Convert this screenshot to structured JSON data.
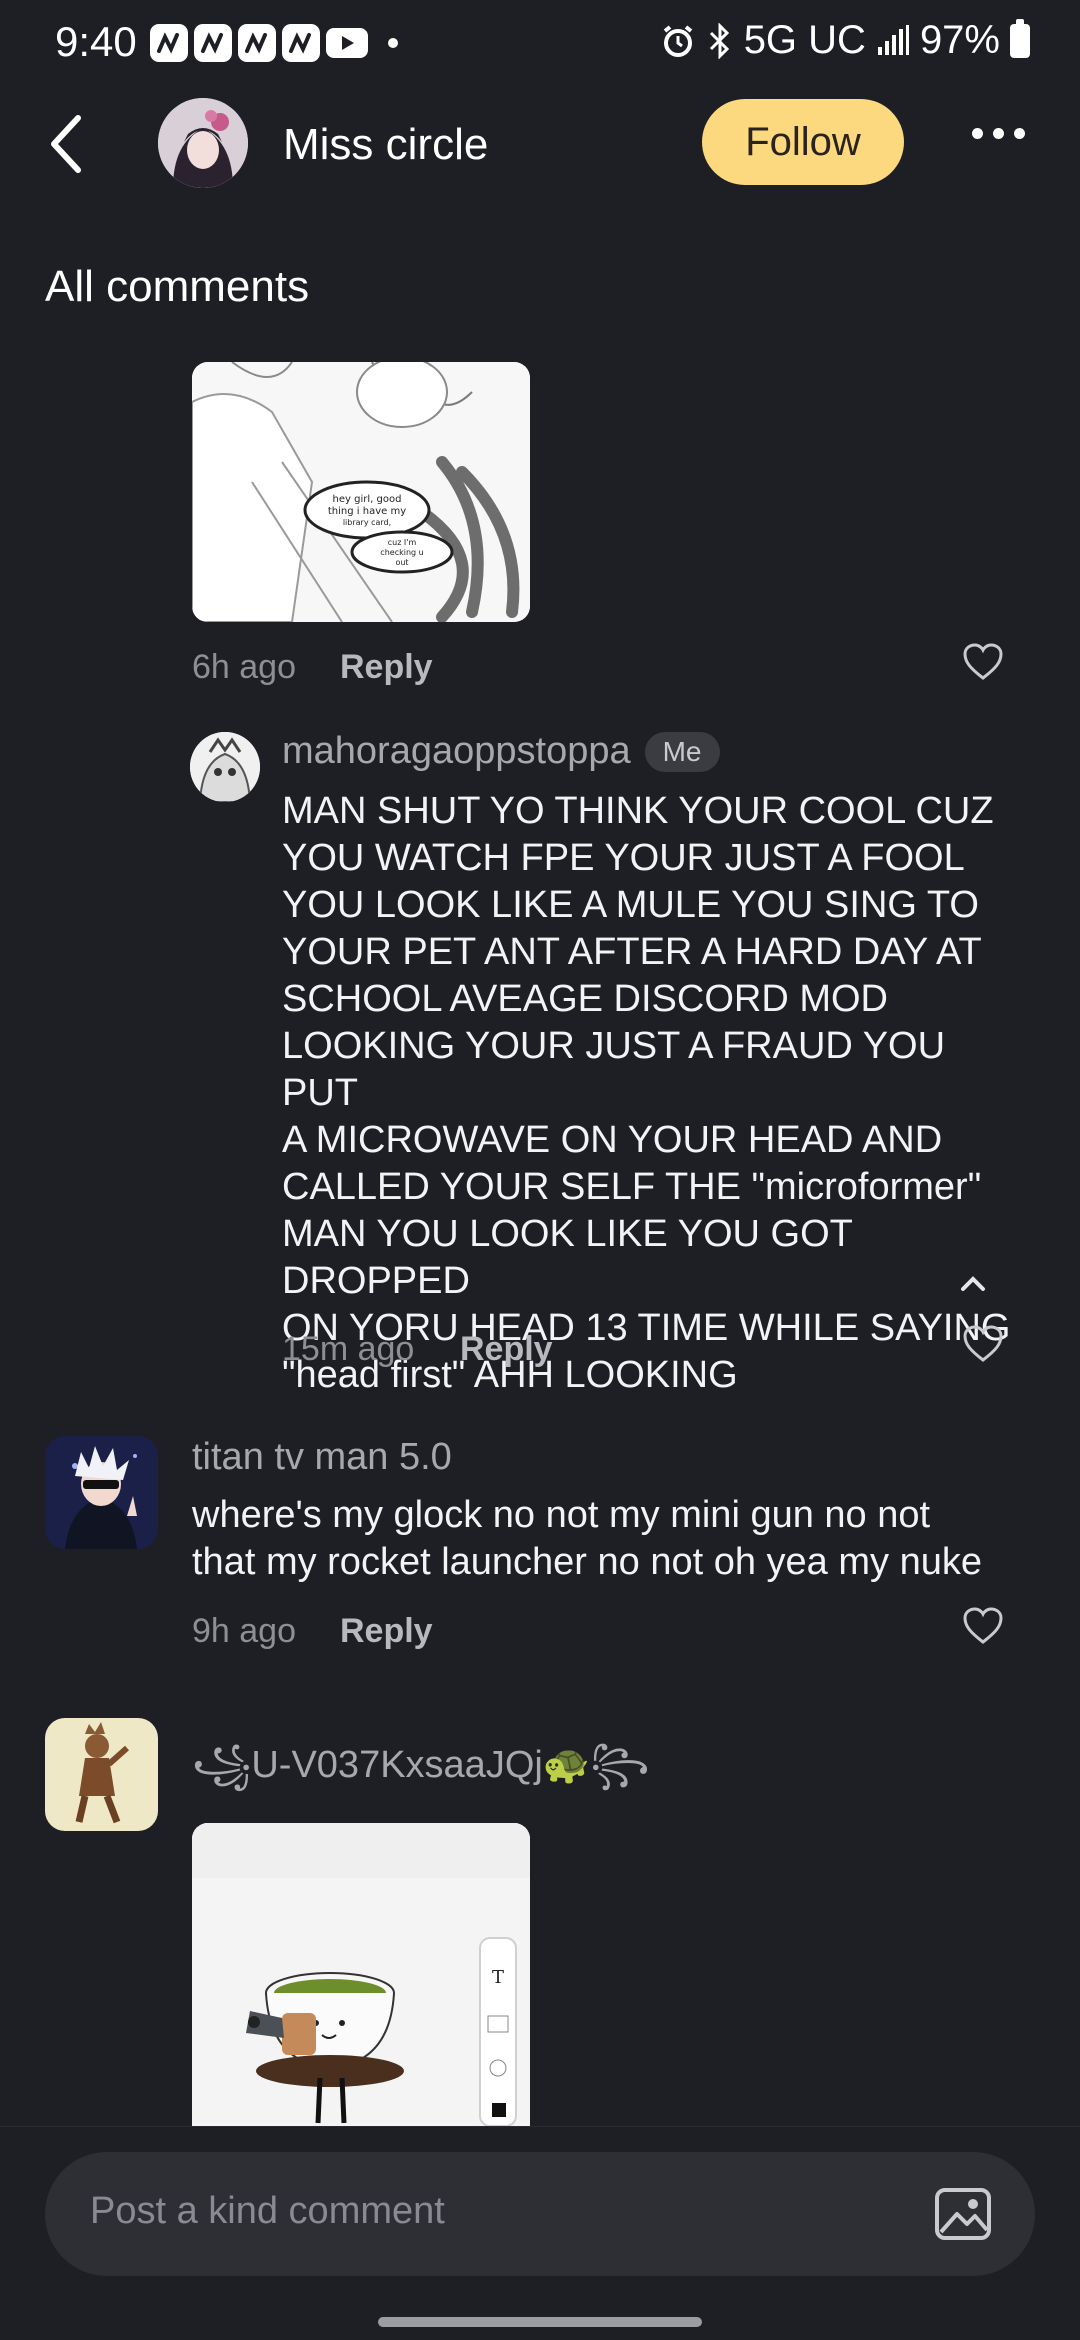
{
  "status_bar": {
    "time": "9:40",
    "network": "5G UC",
    "battery": "97%",
    "icons": [
      "notification-icon",
      "notification-icon",
      "notification-icon",
      "notification-icon",
      "youtube-icon",
      "dot-icon",
      "alarm-icon",
      "bluetooth-icon",
      "signal-icon",
      "battery-icon"
    ]
  },
  "header": {
    "name": "Miss circle",
    "follow_label": "Follow"
  },
  "section_title": "All comments",
  "comments": [
    {
      "time": "6h ago",
      "reply_label": "Reply",
      "image_caption": [
        "hey girl, good",
        "thing i have my",
        "library card,",
        "cuz I'm",
        "checking u",
        "out"
      ]
    },
    {
      "username": "mahoragaoppstoppa",
      "badge": "Me",
      "text_lines": [
        "MAN SHUT YO THINK YOUR COOL CUZ",
        "YOU WATCH FPE YOUR JUST A FOOL",
        "YOU LOOK LIKE A MULE YOU SING TO",
        "YOUR PET ANT AFTER A HARD DAY AT",
        "SCHOOL AVEAGE DISCORD MOD",
        "LOOKING YOUR JUST A FRAUD YOU PUT",
        "A MICROWAVE ON YOUR HEAD AND",
        "CALLED YOUR SELF THE \"microformer\"",
        "MAN YOU LOOK LIKE YOU GOT DROPPED",
        "ON YORU HEAD 13 TIME WHILE SAYING",
        "\"head first\" AHH LOOKING"
      ],
      "time": "15m ago",
      "reply_label": "Reply"
    },
    {
      "username": "titan tv man 5.0",
      "text_lines": [
        "where's my glock no not my mini gun no not",
        "that my rocket launcher no not oh yea my nuke"
      ],
      "time": "9h ago",
      "reply_label": "Reply"
    },
    {
      "username": "꧁U-V037KxsaaJQj🐢꧂"
    }
  ],
  "bottom": {
    "placeholder": "Post a kind comment"
  },
  "colors": {
    "background": "#1e1f24",
    "follow_button": "#fcd97e",
    "input": "#2e2f35"
  }
}
